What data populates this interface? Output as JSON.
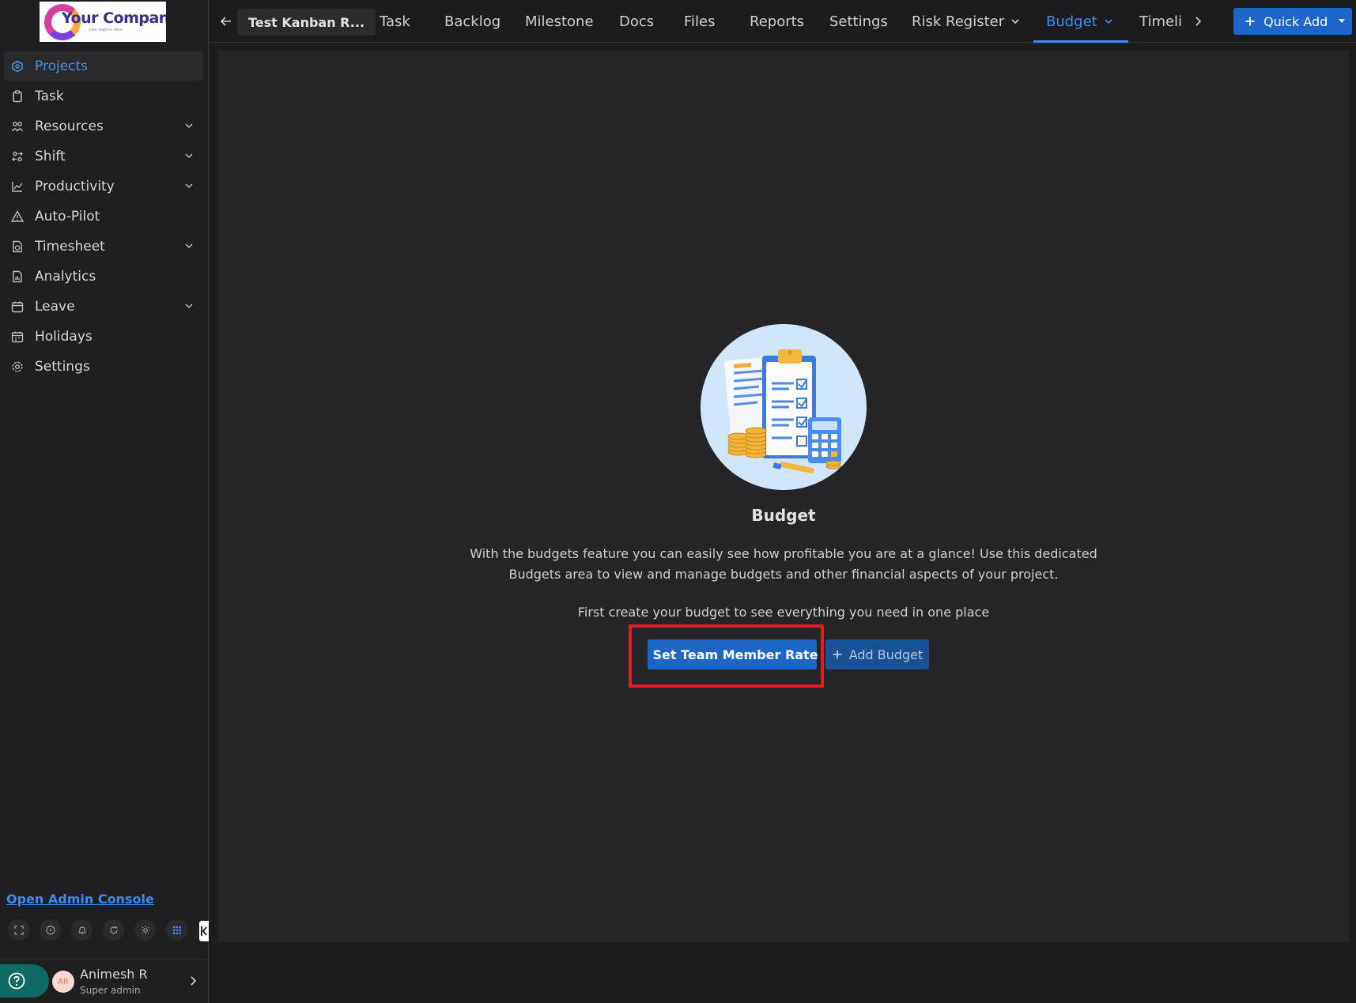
{
  "brand": {
    "logo_text": "Your Company",
    "logo_tagline": "your tagline here"
  },
  "sidebar": {
    "items": [
      {
        "label": "Projects",
        "icon": "projects-icon",
        "active": true,
        "expandable": false
      },
      {
        "label": "Task",
        "icon": "task-icon",
        "active": false,
        "expandable": false
      },
      {
        "label": "Resources",
        "icon": "resources-icon",
        "active": false,
        "expandable": true
      },
      {
        "label": "Shift",
        "icon": "shift-icon",
        "active": false,
        "expandable": true
      },
      {
        "label": "Productivity",
        "icon": "productivity-icon",
        "active": false,
        "expandable": true
      },
      {
        "label": "Auto-Pilot",
        "icon": "auto-pilot-icon",
        "active": false,
        "expandable": false
      },
      {
        "label": "Timesheet",
        "icon": "timesheet-icon",
        "active": false,
        "expandable": true
      },
      {
        "label": "Analytics",
        "icon": "analytics-icon",
        "active": false,
        "expandable": false
      },
      {
        "label": "Leave",
        "icon": "leave-icon",
        "active": false,
        "expandable": true
      },
      {
        "label": "Holidays",
        "icon": "holidays-icon",
        "active": false,
        "expandable": false
      },
      {
        "label": "Settings",
        "icon": "settings-icon",
        "active": false,
        "expandable": false
      }
    ],
    "admin_link": "Open Admin Console",
    "tools": [
      "fullscreen-icon",
      "help-circle-icon",
      "bell-icon",
      "refresh-icon",
      "sun-icon",
      "apps-grid-icon"
    ],
    "user": {
      "initials": "AR",
      "name": "Animesh R",
      "role": "Super admin"
    }
  },
  "topbar": {
    "project_name": "Test Kanban R...",
    "tabs": [
      {
        "label": "Task",
        "active": false,
        "dropdown": false
      },
      {
        "label": "Backlog",
        "active": false,
        "dropdown": false
      },
      {
        "label": "Milestone",
        "active": false,
        "dropdown": false
      },
      {
        "label": "Docs",
        "active": false,
        "dropdown": false
      },
      {
        "label": "Files",
        "active": false,
        "dropdown": false
      },
      {
        "label": "Reports",
        "active": false,
        "dropdown": false
      },
      {
        "label": "Settings",
        "active": false,
        "dropdown": false
      },
      {
        "label": "Risk Register",
        "active": false,
        "dropdown": true
      },
      {
        "label": "Budget",
        "active": true,
        "dropdown": true
      },
      {
        "label": "Timeli",
        "active": false,
        "dropdown": false
      }
    ],
    "quick_add": "Quick Add"
  },
  "empty_state": {
    "illustration": "budget-clipboard-illustration",
    "title": "Budget",
    "description": "With the budgets feature you can easily see how profitable you are at a glance! Use this dedicated Budgets area to view and manage budgets and other financial aspects of your project.",
    "cta_text": "First create your budget to see everything you need in one place",
    "primary_button": "Set Team Member Rate",
    "secondary_button": "Add Budget"
  },
  "colors": {
    "accent": "#3d8bf2",
    "primary_button": "#1d66c9",
    "secondary_button": "#1b4f96",
    "highlight": "#e01c24",
    "help_pill": "#0f6a64"
  }
}
